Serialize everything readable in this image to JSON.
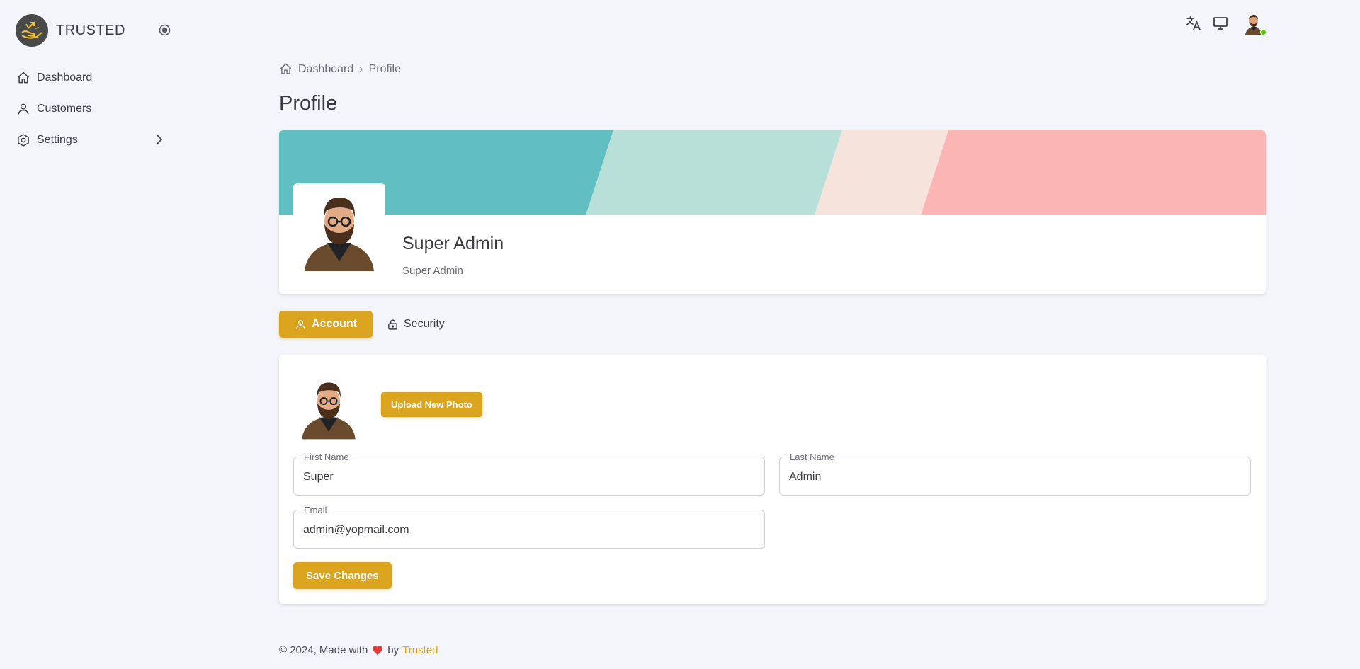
{
  "brand": {
    "name": "TRUSTED"
  },
  "sidebar": {
    "items": [
      {
        "label": "Dashboard",
        "icon": "home-icon"
      },
      {
        "label": "Customers",
        "icon": "user-icon"
      },
      {
        "label": "Settings",
        "icon": "gear-icon",
        "has_children": true
      }
    ]
  },
  "topbar": {
    "icons": [
      "translate-icon",
      "monitor-icon"
    ],
    "user_online": true
  },
  "breadcrumb": {
    "home": "Dashboard",
    "separator": "›",
    "current": "Profile"
  },
  "page_title": "Profile",
  "profile": {
    "name": "Super Admin",
    "role": "Super Admin"
  },
  "tabs": [
    {
      "label": "Account",
      "active": true,
      "icon": "user-icon"
    },
    {
      "label": "Security",
      "active": false,
      "icon": "lock-icon"
    }
  ],
  "account": {
    "upload_label": "Upload New Photo",
    "first_name": {
      "label": "First Name",
      "value": "Super"
    },
    "last_name": {
      "label": "Last Name",
      "value": "Admin"
    },
    "email": {
      "label": "Email",
      "value": "admin@yopmail.com"
    },
    "save_label": "Save Changes"
  },
  "footer": {
    "text": "© 2024, Made with",
    "by": "by",
    "brand": "Trusted"
  },
  "colors": {
    "accent": "#dba41e",
    "banner": [
      "#62bfc1",
      "#b8e0d8",
      "#f6e4dc",
      "#fcb5b5"
    ]
  }
}
